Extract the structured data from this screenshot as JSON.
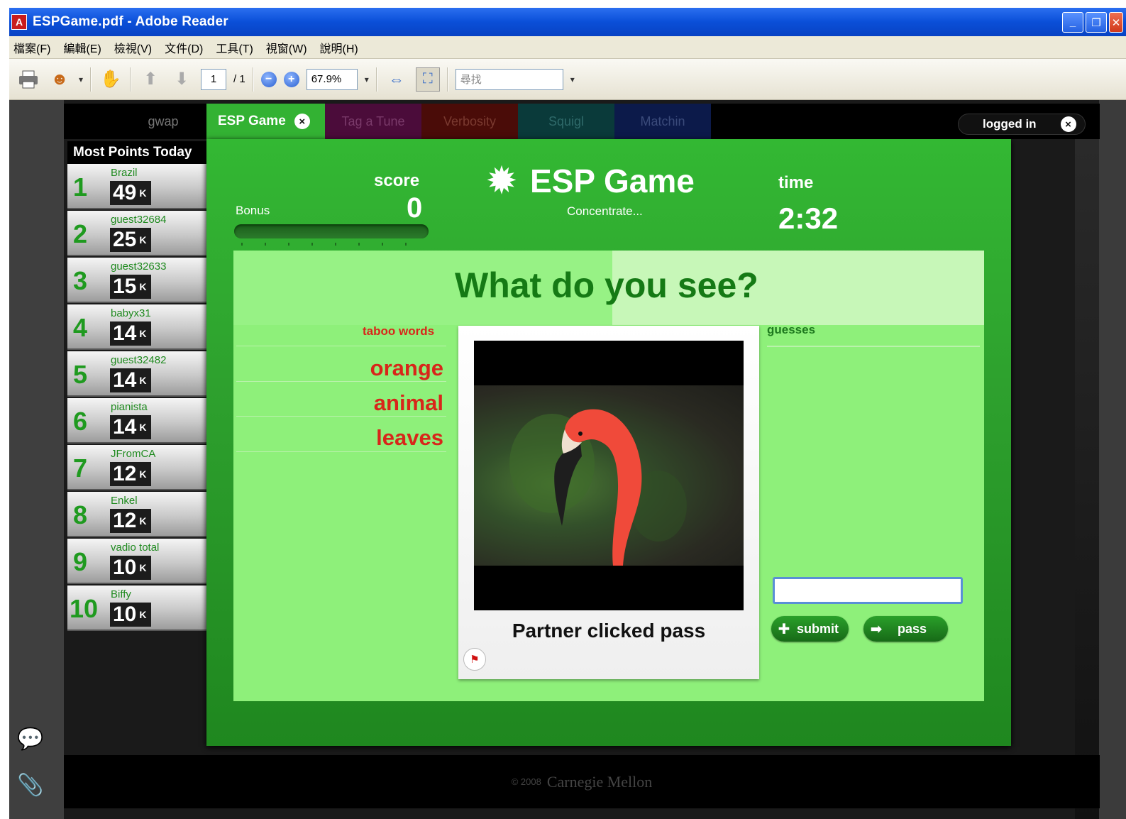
{
  "window": {
    "title": "ESPGame.pdf - Adobe Reader",
    "app_icon": "pdf-icon",
    "controls": [
      "minimize-icon",
      "restore-icon",
      "close-icon"
    ]
  },
  "menu": [
    {
      "label": "檔案(F)"
    },
    {
      "label": "編輯(E)"
    },
    {
      "label": "檢視(V)"
    },
    {
      "label": "文件(D)"
    },
    {
      "label": "工具(T)"
    },
    {
      "label": "視窗(W)"
    },
    {
      "label": "說明(H)"
    }
  ],
  "toolbar": {
    "page_current": "1",
    "page_total": "/ 1",
    "zoom": "67.9%",
    "search_value": "尋找"
  },
  "nav": {
    "brand": "gwap",
    "tabs": [
      {
        "label": "ESP Game"
      },
      {
        "label": "Tag a Tune"
      },
      {
        "label": "Verbosity"
      },
      {
        "label": "Squigl"
      },
      {
        "label": "Matchin"
      }
    ],
    "account": "logged in"
  },
  "leaderboard": {
    "title": "Most Points Today",
    "unit": "K",
    "rows": [
      {
        "rank": "1",
        "name": "Brazil",
        "points": "49"
      },
      {
        "rank": "2",
        "name": "guest32684",
        "points": "25"
      },
      {
        "rank": "3",
        "name": "guest32633",
        "points": "15"
      },
      {
        "rank": "4",
        "name": "babyx31",
        "points": "14"
      },
      {
        "rank": "5",
        "name": "guest32482",
        "points": "14"
      },
      {
        "rank": "6",
        "name": "pianista",
        "points": "14"
      },
      {
        "rank": "7",
        "name": "JFromCA",
        "points": "12"
      },
      {
        "rank": "8",
        "name": "Enkel",
        "points": "12"
      },
      {
        "rank": "9",
        "name": "vadio total",
        "points": "10"
      },
      {
        "rank": "10",
        "name": "Biffy",
        "points": "10"
      }
    ]
  },
  "game": {
    "title": "ESP Game",
    "subtitle": "Concentrate...",
    "score_label": "score",
    "score": "0",
    "bonus_label": "Bonus",
    "bonus_level": 0,
    "time_label": "time",
    "time": "2:32",
    "question": "What do you see?",
    "taboo_label": "taboo words",
    "taboo_words": [
      "orange",
      "animal",
      "leaves"
    ],
    "guesses_label": "guesses",
    "caption": "Partner clicked pass",
    "guess_value": "",
    "submit_label": "submit",
    "pass_label": "pass"
  },
  "footer": {
    "copyright": "© 2008",
    "org": "Carnegie Mellon"
  },
  "colors": {
    "game_green": "#2ea12e",
    "play_green": "#8ef07a",
    "taboo_red": "#d8261a",
    "question_green": "#157a15",
    "xp_blue": "#0a4fd8"
  }
}
